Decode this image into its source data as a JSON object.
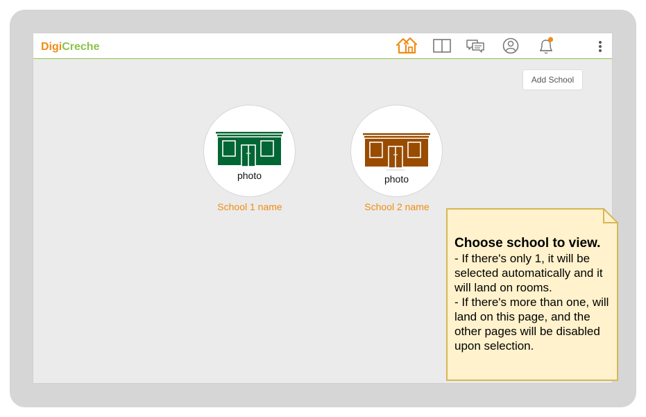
{
  "app": {
    "brand_part1": "Digi",
    "brand_part2": "Creche"
  },
  "nav": {
    "icons": [
      "home-icon",
      "book-icon",
      "chat-icon",
      "profile-icon",
      "bell-icon",
      "more-vertical-icon"
    ],
    "active": "home-icon"
  },
  "toolbar": {
    "add_school_label": "Add School"
  },
  "schools": [
    {
      "photo_label": "photo",
      "name": "School 1 name",
      "color": "#006633"
    },
    {
      "photo_label": "photo",
      "name": "School 2 name",
      "color": "#994c00"
    }
  ],
  "note": {
    "title": "Choose school to view.",
    "lines": [
      "- If there's only 1, it will be selected automatically and it will land on rooms.",
      "- If there's more than one, will land on this page, and the other pages will be disabled upon selection."
    ]
  },
  "colors": {
    "accent": "#f08c12",
    "brand_green": "#8bc34a",
    "note_fill": "#fff2cc",
    "note_border": "#d6b656",
    "notification_dot": "#f08c12"
  }
}
